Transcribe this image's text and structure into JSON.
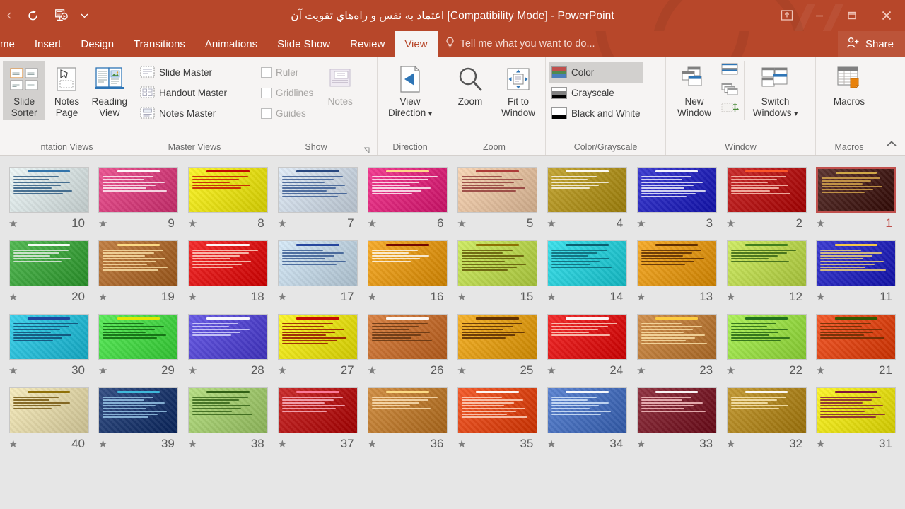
{
  "window": {
    "title": "اعتماد به نفس و راه‌هاي تقويت آن [Compatibility Mode] - PowerPoint",
    "accent_color": "#b7472a",
    "quick_access": [
      {
        "name": "redo",
        "label": "Redo"
      },
      {
        "name": "start-from-beginning",
        "label": "Start From Beginning"
      },
      {
        "name": "customize-qat",
        "label": "Customize Quick Access Toolbar"
      }
    ],
    "controls": [
      {
        "name": "ribbon-display-options",
        "label": "Ribbon Display Options"
      },
      {
        "name": "minimize",
        "label": "Minimize"
      },
      {
        "name": "restore",
        "label": "Restore Down"
      },
      {
        "name": "close",
        "label": "Close"
      }
    ]
  },
  "tabs": [
    {
      "label": "me",
      "active": false
    },
    {
      "label": "Insert",
      "active": false
    },
    {
      "label": "Design",
      "active": false
    },
    {
      "label": "Transitions",
      "active": false
    },
    {
      "label": "Animations",
      "active": false
    },
    {
      "label": "Slide Show",
      "active": false
    },
    {
      "label": "Review",
      "active": false
    },
    {
      "label": "View",
      "active": true
    }
  ],
  "tellme": {
    "placeholder": "Tell me what you want to do...",
    "icon": "lightbulb-icon"
  },
  "share": {
    "label": "Share",
    "icon": "person-add-icon"
  },
  "ribbon": {
    "groups": [
      {
        "title": "ntation Views",
        "buttons": [
          {
            "label": "Slide\nSorter",
            "selected": true,
            "icon": "slide-sorter-icon"
          },
          {
            "label": "Notes\nPage",
            "selected": false,
            "icon": "notes-page-icon"
          },
          {
            "label": "Reading\nView",
            "selected": false,
            "icon": "reading-view-icon"
          }
        ]
      },
      {
        "title": "Master Views",
        "items": [
          {
            "label": "Slide Master",
            "icon": "slide-master-icon"
          },
          {
            "label": "Handout Master",
            "icon": "handout-master-icon"
          },
          {
            "label": "Notes Master",
            "icon": "notes-master-icon"
          }
        ]
      },
      {
        "title": "Show",
        "checkboxes": [
          {
            "label": "Ruler",
            "checked": false,
            "disabled": true
          },
          {
            "label": "Gridlines",
            "checked": false,
            "disabled": true
          },
          {
            "label": "Guides",
            "checked": false,
            "disabled": true
          }
        ],
        "buttons": [
          {
            "label": "Notes",
            "disabled": true,
            "icon": "notes-icon"
          }
        ],
        "has_dialog_launcher": true
      },
      {
        "title": "Direction",
        "buttons": [
          {
            "label": "View\nDirection",
            "dropdown": true,
            "icon": "view-direction-icon"
          }
        ]
      },
      {
        "title": "Zoom",
        "buttons": [
          {
            "label": "Zoom",
            "icon": "magnifier-icon"
          },
          {
            "label": "Fit to\nWindow",
            "icon": "fit-to-window-icon"
          }
        ]
      },
      {
        "title": "Color/Grayscale",
        "items": [
          {
            "label": "Color",
            "selected": true,
            "swatch": [
              "#c0504d",
              "#4f8a4f",
              "#4a7ebb"
            ]
          },
          {
            "label": "Grayscale",
            "selected": false,
            "swatch": [
              "#ffffff",
              "#808080",
              "#000000"
            ]
          },
          {
            "label": "Black and White",
            "selected": false,
            "swatch": [
              "#ffffff",
              "#ffffff",
              "#000000"
            ]
          }
        ]
      },
      {
        "title": "Window",
        "buttons": [
          {
            "label": "New\nWindow",
            "icon": "new-window-icon"
          },
          {
            "label": "Switch\nWindows",
            "dropdown": true,
            "icon": "switch-windows-icon"
          }
        ],
        "small_icons": [
          {
            "name": "arrange-all-icon"
          },
          {
            "name": "cascade-icon"
          },
          {
            "name": "move-split-icon"
          }
        ]
      },
      {
        "title": "Macros",
        "buttons": [
          {
            "label": "Macros",
            "icon": "macros-icon"
          }
        ]
      }
    ],
    "collapse_label": "Collapse the Ribbon",
    "collapse_icon": "chevron-up-icon"
  },
  "sorter": {
    "rtl": true,
    "selected_slide": 1,
    "rows": [
      [
        {
          "n": 10,
          "bg": "#eaf6f6",
          "accent": "#2a6fa8",
          "text": "#1f4f7a",
          "art": "grid-teal",
          "starred": true
        },
        {
          "n": 9,
          "bg": "#e8327c",
          "accent": "#ffffff",
          "text": "#ffffff",
          "art": "pink-flower",
          "starred": true
        },
        {
          "n": 8,
          "bg": "#fdf400",
          "accent": "#c00000",
          "text": "#c00000",
          "art": "yellow-photo",
          "starred": true
        },
        {
          "n": 7,
          "bg": "#dce9f7",
          "accent": "#1f3f7a",
          "text": "#2b4f8a",
          "art": "blue-columns",
          "starred": true
        },
        {
          "n": 6,
          "bg": "#f0147a",
          "accent": "#ffe08a",
          "text": "#ffffff",
          "art": "magenta-leaf",
          "starred": true
        },
        {
          "n": 5,
          "bg": "#f8cda6",
          "accent": "#a33",
          "text": "#8a2f2f",
          "art": "balance-scale",
          "starred": true
        },
        {
          "n": 4,
          "bg": "#b8940b",
          "accent": "#ffffff",
          "text": "#ffffff",
          "art": "olive-photo",
          "starred": true
        },
        {
          "n": 3,
          "bg": "#1414c8",
          "accent": "#ffffff",
          "text": "#ffffff",
          "art": "blue-grid-shapes",
          "starred": true
        },
        {
          "n": 2,
          "bg": "#c00000",
          "accent": "#ff5a2a",
          "text": "#ffd0c0",
          "art": "red-gradient",
          "starred": true
        },
        {
          "n": 1,
          "bg": "#3a0b06",
          "accent": "#d8b04a",
          "text": "#e0b050",
          "art": "dark-curtain",
          "starred": true
        }
      ],
      [
        {
          "n": 20,
          "bg": "#2faa2f",
          "accent": "#ffffff",
          "text": "#f0f0f0",
          "art": "green-gradient-bars",
          "starred": true
        },
        {
          "n": 19,
          "bg": "#b5651d",
          "accent": "#ffe08a",
          "text": "#ffe8b0",
          "art": "brown-dashed",
          "starred": true
        },
        {
          "n": 18,
          "bg": "#f20000",
          "accent": "#ffffff",
          "text": "#ffe0d0",
          "art": "red-plain",
          "starred": true
        },
        {
          "n": 17,
          "bg": "#cfe6f7",
          "accent": "#1f3f9a",
          "text": "#2b4f8a",
          "art": "blue-lattice",
          "starred": true
        },
        {
          "n": 16,
          "bg": "#f59b00",
          "accent": "#6b0000",
          "text": "#ffffff",
          "art": "orange-dark-title",
          "starred": true
        },
        {
          "n": 15,
          "bg": "#c6e845",
          "accent": "#8a6a00",
          "text": "#5a4a00",
          "art": "lime-flowers",
          "starred": true
        },
        {
          "n": 14,
          "bg": "#16dbe8",
          "accent": "#0a5a6a",
          "text": "#0a5a6a",
          "art": "cyan-swirl",
          "starred": true
        },
        {
          "n": 13,
          "bg": "#f59b00",
          "accent": "#5a2a00",
          "text": "#4a2000",
          "art": "orange-scale",
          "starred": true
        },
        {
          "n": 12,
          "bg": "#c6e845",
          "accent": "#3a7a1a",
          "text": "#2a5a10",
          "art": "lime-green-box",
          "starred": true
        },
        {
          "n": 11,
          "bg": "#1414c8",
          "accent": "#ffd040",
          "text": "#ffe070",
          "art": "blue-orange-abstract",
          "starred": true
        }
      ],
      [
        {
          "n": 30,
          "bg": "#16c8e8",
          "accent": "#1f3f9a",
          "text": "#10406a",
          "art": "cyan-photo",
          "starred": true
        },
        {
          "n": 29,
          "bg": "#3ae83a",
          "accent": "#e8e800",
          "text": "#0a5a0a",
          "art": "green-portrait",
          "starred": true
        },
        {
          "n": 28,
          "bg": "#4a3ae0",
          "accent": "#ffffff",
          "text": "#e0e0ff",
          "art": "violet-plain",
          "starred": true
        },
        {
          "n": 27,
          "bg": "#fdf400",
          "accent": "#c00000",
          "text": "#8a0000",
          "art": "yellow-photo-frame",
          "starred": true
        },
        {
          "n": 26,
          "bg": "#d2691e",
          "accent": "#ffffff",
          "text": "#5a3010",
          "art": "brown-parchment",
          "starred": true
        },
        {
          "n": 25,
          "bg": "#f5a300",
          "accent": "#5a2a00",
          "text": "#4a2000",
          "art": "orange-tower",
          "starred": true
        },
        {
          "n": 24,
          "bg": "#f20000",
          "accent": "#ffffff",
          "text": "#ffe0d0",
          "art": "red-plain-2",
          "starred": true
        },
        {
          "n": 23,
          "bg": "#c87a2a",
          "accent": "#ffd040",
          "text": "#ffe8b0",
          "art": "tan-photo-flower",
          "starred": true
        },
        {
          "n": 22,
          "bg": "#9ef03a",
          "accent": "#1a6a1a",
          "text": "#1a5a10",
          "art": "lime-grid",
          "starred": true
        },
        {
          "n": 21,
          "bg": "#f23a00",
          "accent": "#2a5a00",
          "text": "#5a2a00",
          "art": "orange-green-bars",
          "starred": true
        }
      ],
      [
        {
          "n": 40,
          "bg": "#f5e8b0",
          "accent": "#8a6a00",
          "text": "#6a4a00",
          "art": "cream-scroll",
          "starred": true
        },
        {
          "n": 39,
          "bg": "#0a2a6a",
          "accent": "#40c0e0",
          "text": "#a0d0f0",
          "art": "navy-flowers",
          "starred": true
        },
        {
          "n": 38,
          "bg": "#a8d86a",
          "accent": "#2a5a10",
          "text": "#2a5a10",
          "art": "green-photo-map",
          "starred": true
        },
        {
          "n": 37,
          "bg": "#c00000",
          "accent": "#ff80a0",
          "text": "#ffc0d0",
          "art": "crimson-plain",
          "starred": true
        },
        {
          "n": 36,
          "bg": "#c8781e",
          "accent": "#ffe08a",
          "text": "#ffe8c0",
          "art": "amber-bars",
          "starred": true
        },
        {
          "n": 35,
          "bg": "#f23a00",
          "accent": "#ffffff",
          "text": "#ffe0d0",
          "art": "vermilion-plain",
          "starred": true
        },
        {
          "n": 34,
          "bg": "#3a6ac8",
          "accent": "#ffffff",
          "text": "#e0f0ff",
          "art": "blue-sea",
          "starred": true
        },
        {
          "n": 33,
          "bg": "#7a0a1a",
          "accent": "#ffffff",
          "text": "#ffd0d0",
          "art": "maroon-can",
          "starred": true
        },
        {
          "n": 32,
          "bg": "#b8860b",
          "accent": "#ffffff",
          "text": "#fff0c0",
          "art": "gold-gradient",
          "starred": true
        },
        {
          "n": 31,
          "bg": "#fdf400",
          "accent": "#7a0a3a",
          "text": "#7a0a3a",
          "art": "yellow-multi-photo",
          "starred": true
        }
      ]
    ]
  }
}
